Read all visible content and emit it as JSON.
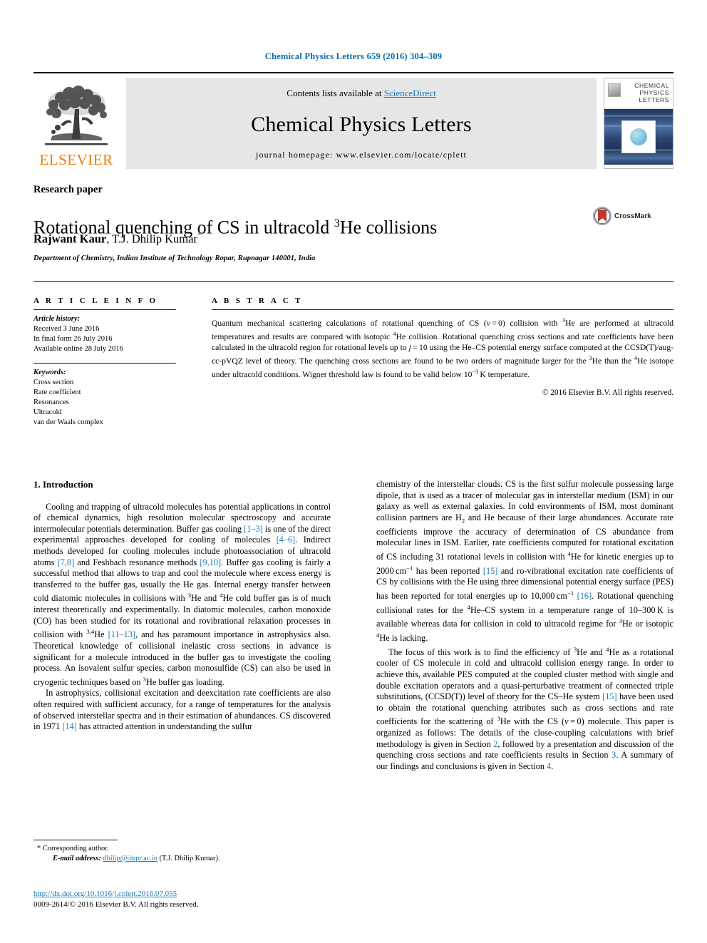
{
  "running_head": "Chemical Physics Letters 659 (2016) 304–309",
  "masthead": {
    "contents_prefix": "Contents lists available at ",
    "sciencedirect": "ScienceDirect",
    "journal_name": "Chemical Physics Letters",
    "homepage": "journal homepage: www.elsevier.com/locate/cplett",
    "publisher": "ELSEVIER",
    "publisher_icon": "elsevier-tree-logo",
    "cover": {
      "title_lines": [
        "CHEMICAL",
        "PHYSICS",
        "LETTERS"
      ],
      "caption": "",
      "footer": ""
    }
  },
  "article": {
    "type": "Research paper",
    "title_prefix": "Rotational quenching of CS in ultracold ",
    "title_sup": "3",
    "title_suffix": "He collisions",
    "authors_first": "Rajwant Kaur",
    "authors_sep": ", ",
    "authors_second": "T.J. Dhilip Kumar",
    "corresponding_marker": "*",
    "affiliation": "Department of Chemistry, Indian Institute of Technology Ropar, Rupnagar 140001, India",
    "crossmark_label": "CrossMark",
    "crossmark_icon": "crossmark-badge-icon"
  },
  "info": {
    "label": "A R T I C L E  I N F O",
    "history_head": "Article history:",
    "history": [
      "Received 3 June 2016",
      "In final form 26 July 2016",
      "Available online 28 July 2016"
    ],
    "keywords_head": "Keywords:",
    "keywords": [
      "Cross section",
      "Rate coefficient",
      "Resonances",
      "Ultracold",
      "van der Waals complex"
    ]
  },
  "abstract": {
    "label": "A B S T R A C T",
    "text_html": "Quantum mechanical scattering calculations of rotational quenching of CS (<i>v</i>&#8239;=&#8239;0) collision with <sup>3</sup>He are performed at ultracold temperatures and results are compared with isotopic <sup>4</sup>He collision. Rotational quenching cross sections and rate coefficients have been calculated in the ultracold region for rotational levels up to <i>j</i>&#8239;=&#8239;10 using the He–CS potential energy surface computed at the CCSD(T)/aug-cc-pVQZ level of theory. The quenching cross sections are found to be two orders of magnitude larger for the <sup>3</sup>He than the <sup>4</sup>He isotope under ultracold conditions. Wigner threshold law is found to be valid below 10<sup>&#8722;3</sup>&#8239;K temperature.",
    "copyright": "© 2016 Elsevier B.V. All rights reserved."
  },
  "body": {
    "section_title": "1. Introduction",
    "left_paragraphs_html": [
      "Cooling and trapping of ultracold molecules has potential applications in control of chemical dynamics, high resolution molecular spectroscopy and accurate intermolecular potentials determination. Buffer gas cooling <span class=\"ref\">[1–3]</span> is one of the direct experimental approaches developed for cooling of molecules <span class=\"ref\">[4–6]</span>. Indirect methods developed for cooling molecules include photoassociation of ultracold atoms <span class=\"ref\">[7,8]</span> and Feshbach resonance methods <span class=\"ref\">[9,10]</span>. Buffer gas cooling is fairly a successful method that allows to trap and cool the molecule where excess energy is transferred to the buffer gas, usually the He gas. Internal energy transfer between cold diatomic molecules in collisions with <sup>3</sup>He and <sup>4</sup>He cold buffer gas is of much interest theoretically and experimentally. In diatomic molecules, carbon monoxide (CO) has been studied for its rotational and rovibrational relaxation processes in collision with <sup>3,4</sup>He <span class=\"ref\">[11–13]</span>, and has paramount importance in astrophysics also. Theoretical knowledge of collisional inelastic cross sections in advance is significant for a molecule introduced in the buffer gas to investigate the cooling process. An isovalent sulfur species, carbon monosulfide (CS) can also be used in cryogenic techniques based on <sup>3</sup>He buffer gas loading.",
      "In astrophysics, collisional excitation and deexcitation rate coefficients are also often required with sufficient accuracy, for a range of temperatures for the analysis of observed interstellar spectra and in their estimation of abundances. CS discovered in 1971 <span class=\"ref\">[14]</span> has attracted attention in understanding the sulfur"
    ],
    "right_paragraphs_html": [
      "chemistry of the interstellar clouds. CS is the first sulfur molecule possessing large dipole, that is used as a tracer of molecular gas in interstellar medium (ISM) in our galaxy as well as external galaxies. In cold environments of ISM, most dominant collision partners are H<sub>2</sub> and He because of their large abundances. Accurate rate coefficients improve the accuracy of determination of CS abundance from molecular lines in ISM. Earlier, rate coefficients computed for rotational excitation of CS including 31 rotational levels in collision with <sup>4</sup>He for kinetic energies up to 2000&#8239;cm<sup>&#8722;1</sup> has been reported <span class=\"ref\">[15]</span> and ro-vibrational excitation rate coefficients of CS by collisions with the He using three dimensional potential energy surface (PES) has been reported for total energies up to 10,000&#8239;cm<sup>&#8722;1</sup> <span class=\"ref\">[16]</span>. Rotational quenching collisional rates for the <sup>4</sup>He–CS system in a temperature range of 10–300&#8239;K is available whereas data for collision in cold to ultracold regime for <sup>3</sup>He or isotopic <sup>4</sup>He is lacking.",
      "The focus of this work is to find the efficiency of <sup>3</sup>He and <sup>4</sup>He as a rotational cooler of CS molecule in cold and ultracold collision energy range. In order to achieve this, available PES computed at the coupled cluster method with single and double excitation operators and a quasi-perturbative treatment of connected triple substitutions, (CCSD(T)) level of theory for the CS–He system <span class=\"ref\">[15]</span> have been used to obtain the rotational quenching attributes such as cross sections and rate coefficients for the scattering of <sup>3</sup>He with the CS (<i>v</i>&#8239;=&#8239;0) molecule. This paper is organized as follows: The details of the close-coupling calculations with brief methodology is given in Section <span class=\"ref\">2</span>, followed by a presentation and discussion of the quenching cross sections and rate coefficients results in Section <span class=\"ref\">3</span>. A summary of our findings and conclusions is given in Section <span class=\"ref\">4</span>."
    ]
  },
  "footnote": {
    "corresponding": "Corresponding author.",
    "corresponding_marker": "*",
    "email_label": "E-mail address:",
    "email": "dhilip@iitrpr.ac.in",
    "email_owner": "(T.J. Dhilip Kumar)."
  },
  "footer": {
    "doi": "http://dx.doi.org/10.1016/j.cplett.2016.07.055",
    "issn_line": "0009-2614/© 2016 Elsevier B.V. All rights reserved."
  },
  "colors": {
    "link": "#1a7bb9",
    "running_head": "#0b6ba8",
    "elsevier_orange": "#f07d00"
  }
}
